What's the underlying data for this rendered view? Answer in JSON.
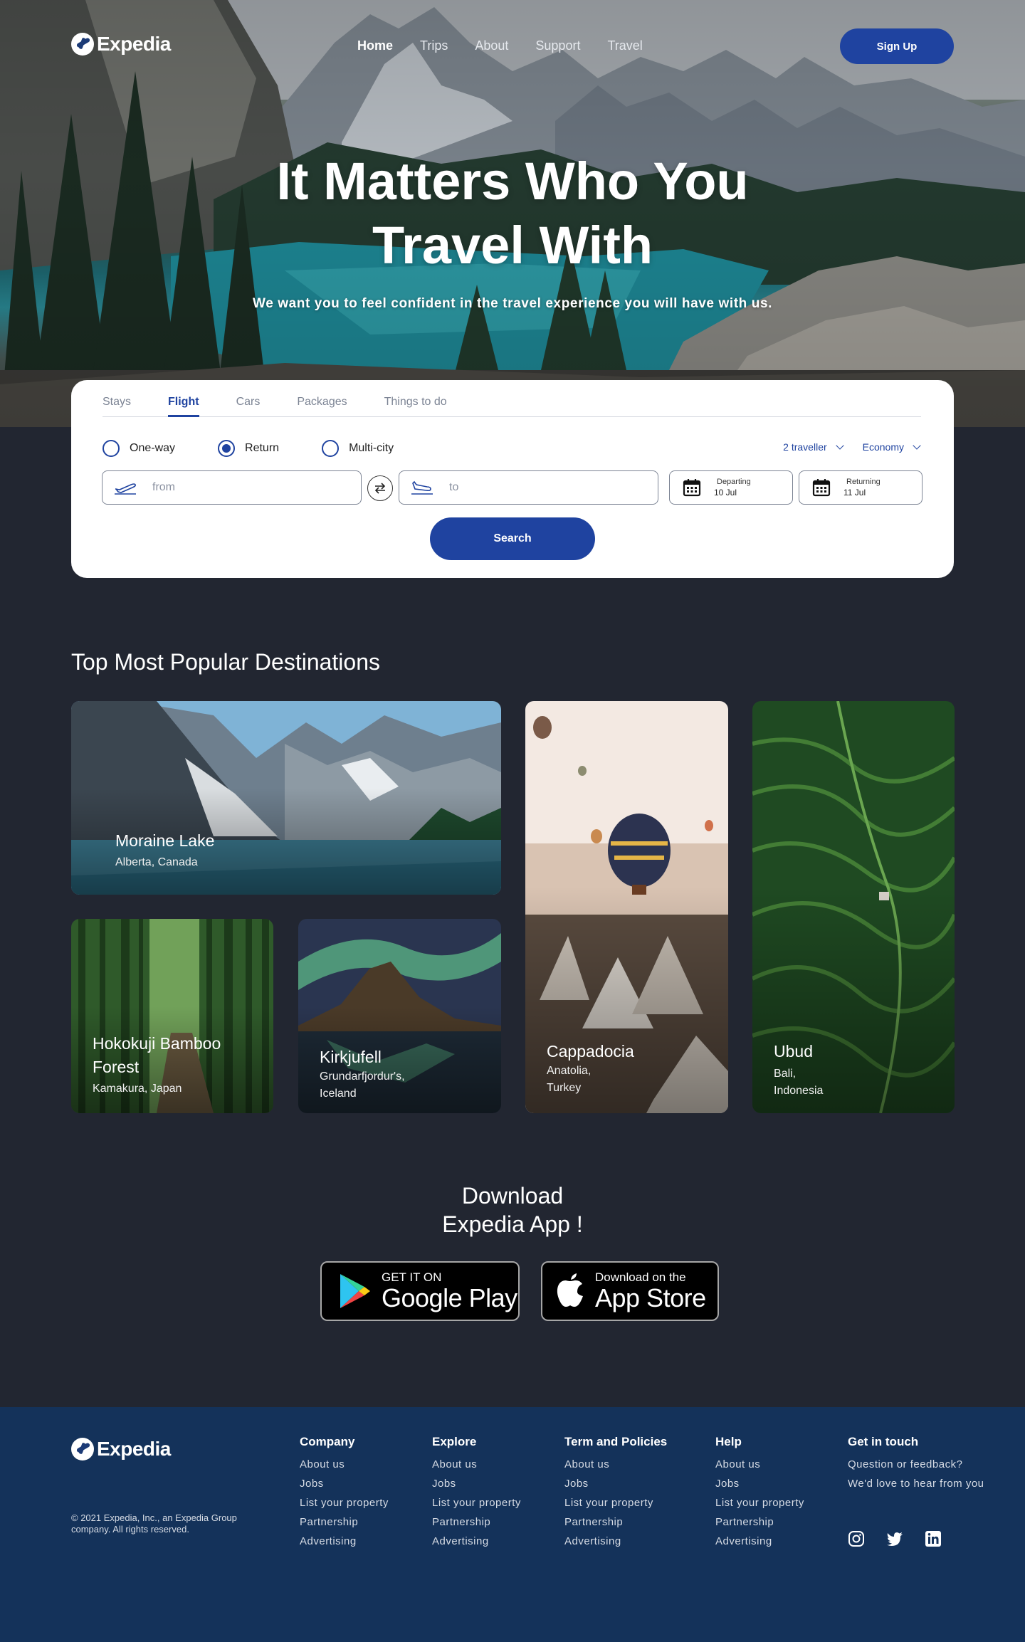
{
  "brand": {
    "name": "Expedia"
  },
  "nav": {
    "items": [
      "Home",
      "Trips",
      "About",
      "Support",
      "Travel"
    ],
    "active": "Home",
    "signup_label": "Sign Up"
  },
  "hero": {
    "title_line1": "It Matters Who You",
    "title_line2": "Travel With",
    "subtitle": "We want you to feel confident in the travel experience you will have with us."
  },
  "search": {
    "tabs": [
      "Stays",
      "Flight",
      "Cars",
      "Packages",
      "Things to do"
    ],
    "active_tab": "Flight",
    "trip_types": [
      "One-way",
      "Return",
      "Multi-city"
    ],
    "selected_trip_type": "Return",
    "travellers": "2 traveller",
    "cabin_class": "Economy",
    "from_placeholder": "from",
    "to_placeholder": "to",
    "departing_label": "Departing",
    "departing_value": "10 Jul",
    "returning_label": "Returning",
    "returning_value": "11 Jul",
    "search_label": "Search"
  },
  "destinations": {
    "title": "Top Most Popular Destinations",
    "items": [
      {
        "name": "Moraine Lake",
        "location": "Alberta, Canada"
      },
      {
        "name": "Hokokuji Bamboo Forest",
        "name_line1": "Hokokuji Bamboo",
        "name_line2": "Forest",
        "location": "Kamakura, Japan"
      },
      {
        "name": "Kirkjufell",
        "location_line1": "Grundarfjordur's,",
        "location_line2": "Iceland"
      },
      {
        "name": "Cappadocia",
        "location_line1": "Anatolia,",
        "location_line2": "Turkey"
      },
      {
        "name": "Ubud",
        "location_line1": "Bali,",
        "location_line2": "Indonesia"
      }
    ]
  },
  "download": {
    "title_line1": "Download",
    "title_line2": "Expedia App !",
    "google_small": "GET IT ON",
    "google_big": "Google Play",
    "apple_small": "Download on the",
    "apple_big": "App Store"
  },
  "footer": {
    "copyright": "© 2021 Expedia, Inc., an Expedia Group company. All rights reserved.",
    "columns": [
      {
        "heading": "Company",
        "links": [
          "About us",
          "Jobs",
          "List your property",
          "Partnership",
          "Advertising"
        ]
      },
      {
        "heading": "Explore",
        "links": [
          "About us",
          "Jobs",
          "List your property",
          "Partnership",
          "Advertising"
        ]
      },
      {
        "heading": "Term and Policies",
        "links": [
          "About us",
          "Jobs",
          "List your property",
          "Partnership",
          "Advertising"
        ]
      },
      {
        "heading": "Help",
        "links": [
          "About us",
          "Jobs",
          "List your property",
          "Partnership",
          "Advertising"
        ]
      }
    ],
    "contact": {
      "heading": "Get in touch",
      "line1": "Question or feedback?",
      "line2": "We'd love to hear from you"
    },
    "social": [
      "instagram-icon",
      "twitter-icon",
      "linkedin-icon"
    ]
  },
  "colors": {
    "accent": "#1f43a0",
    "page_bg": "#222631",
    "footer_bg": "#14325a"
  }
}
